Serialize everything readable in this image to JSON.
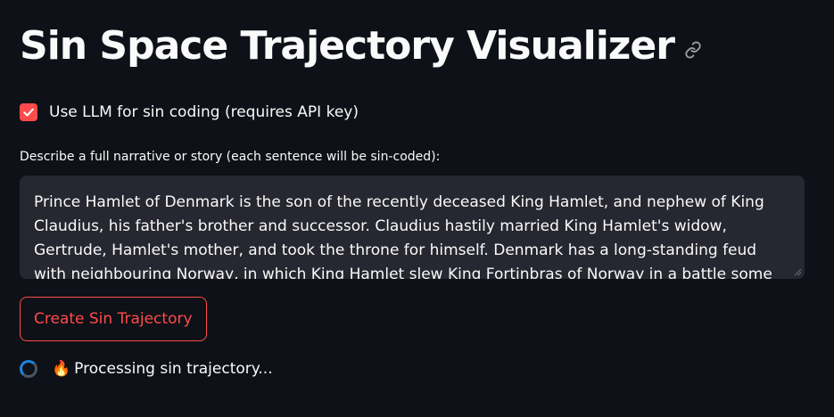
{
  "header": {
    "title": "Sin Space Trajectory Visualizer",
    "anchor_icon": "link-icon"
  },
  "options": {
    "use_llm_label": "Use LLM for sin coding (requires API key)",
    "use_llm_checked": true
  },
  "narrative": {
    "label": "Describe a full narrative or story (each sentence will be sin-coded):",
    "value": "Prince Hamlet of Denmark is the son of the recently deceased King Hamlet, and nephew of King Claudius, his father's brother and successor. Claudius hastily married King Hamlet's widow, Gertrude, Hamlet's mother, and took the throne for himself. Denmark has a long-standing feud with neighbouring Norway, in which King Hamlet slew King Fortinbras of Norway in a battle some years"
  },
  "actions": {
    "create_label": "Create Sin Trajectory"
  },
  "status": {
    "emoji": "🔥",
    "text": "Processing sin trajectory..."
  },
  "colors": {
    "background": "#0e1117",
    "accent": "#ff4b4b",
    "input_bg": "#262730",
    "spinner": "#1c83e1"
  }
}
